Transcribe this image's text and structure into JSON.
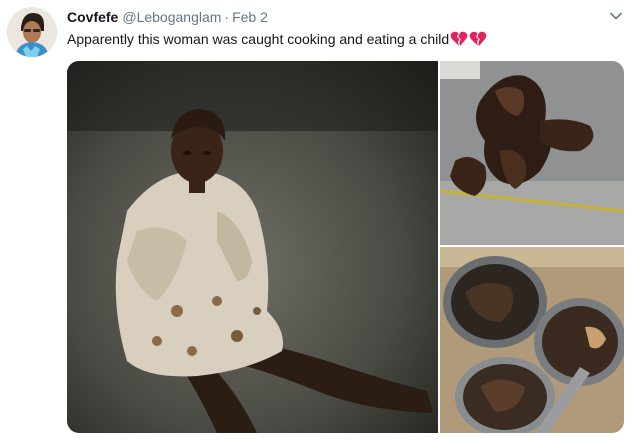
{
  "tweet": {
    "display_name": "Covfefe",
    "handle": "@Leboganglam",
    "separator": "·",
    "date": "Feb 2",
    "text": "Apparently this woman was caught cooking and eating a child",
    "emoji": [
      "broken-heart-icon",
      "broken-heart-icon"
    ],
    "accent_color": "#e0245e"
  },
  "media": {
    "count": 3,
    "items": [
      "photo-woman-seated",
      "photo-charred-meat-tray",
      "photo-cooking-pots"
    ]
  }
}
